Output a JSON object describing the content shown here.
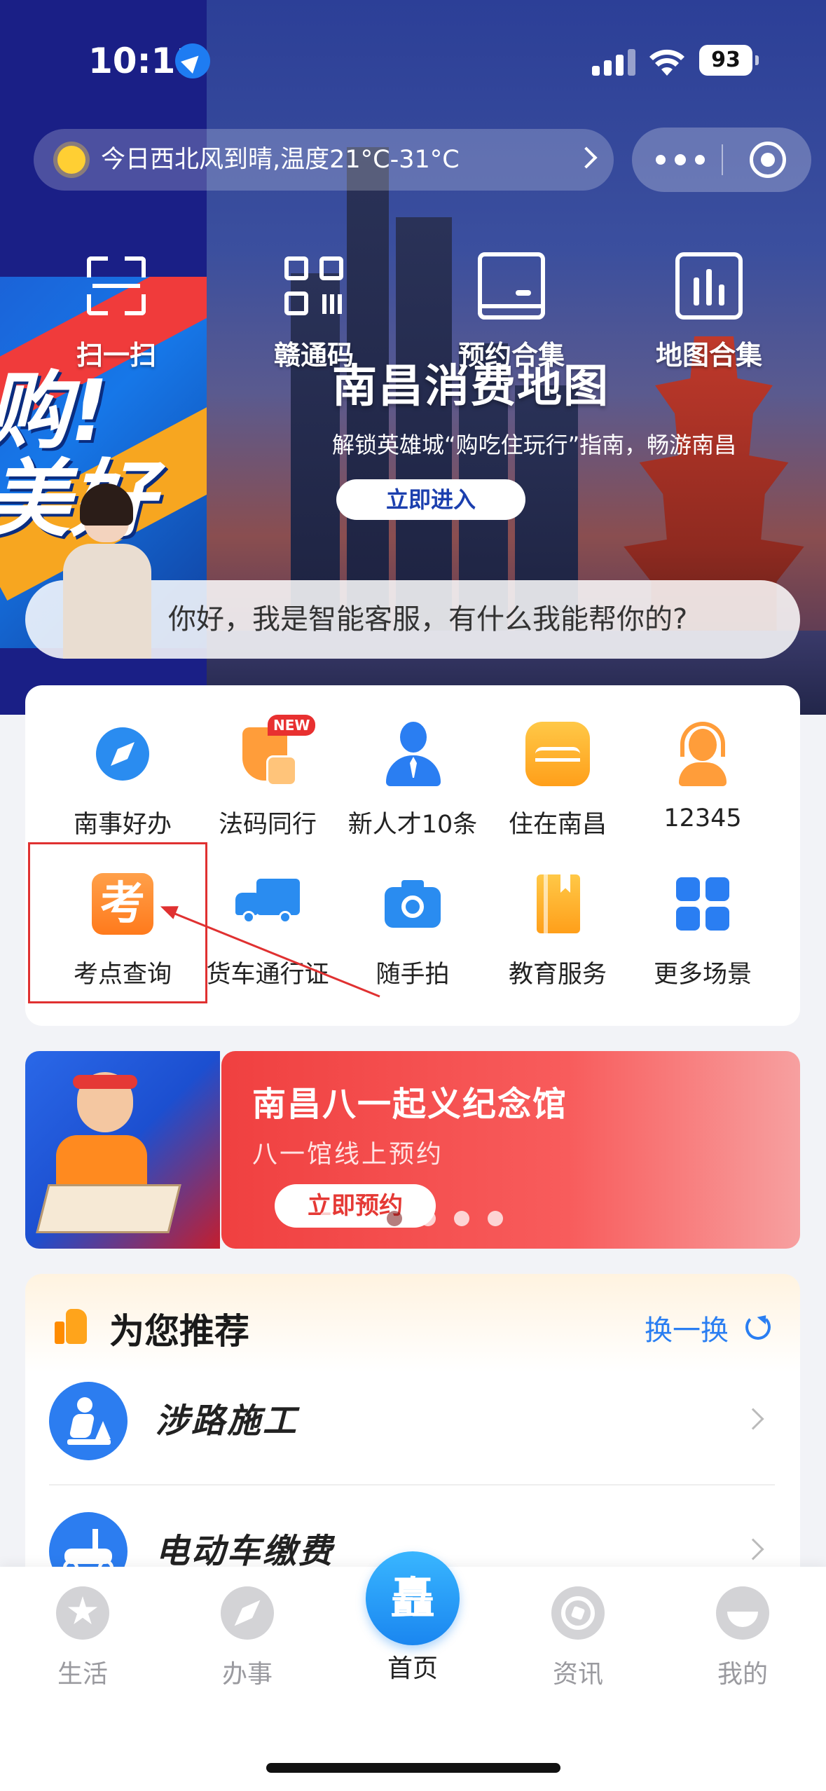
{
  "status_bar": {
    "time": "10:11",
    "battery": "93"
  },
  "weather": {
    "text": "今日西北风到晴,温度21°C-31°C"
  },
  "quick_actions": [
    {
      "label": "扫一扫",
      "icon": "scan-icon"
    },
    {
      "label": "赣通码",
      "icon": "qr-code-icon"
    },
    {
      "label": "预约合集",
      "icon": "appointment-icon"
    },
    {
      "label": "地图合集",
      "icon": "map-icon"
    }
  ],
  "hero": {
    "title": "南昌消费地图",
    "subtitle": "解锁英雄城“购吃住玩行”指南，畅游南昌",
    "button": "立即进入",
    "left_art_text": "购!\n美好"
  },
  "assistant": {
    "greeting": "你好，我是智能客服，有什么我能帮你的?"
  },
  "services": [
    {
      "label": "南事好办",
      "icon": "compass-icon",
      "color": "#2a8cf0"
    },
    {
      "label": "法码同行",
      "icon": "law-badge-icon",
      "color": "#ff9d3a",
      "badge": "NEW"
    },
    {
      "label": "新人才10条",
      "icon": "person-icon",
      "color": "#2a7ef2"
    },
    {
      "label": "住在南昌",
      "icon": "housing-icon",
      "color": "#ffb22c"
    },
    {
      "label": "12345",
      "icon": "headset-icon",
      "color": "#ff9d3a"
    },
    {
      "label": "考点查询",
      "icon": "exam-icon",
      "color": "#ff8c2a",
      "glyph": "考"
    },
    {
      "label": "货车通行证",
      "icon": "truck-icon",
      "color": "#2a8cf0"
    },
    {
      "label": "随手拍",
      "icon": "camera-icon",
      "color": "#2a8cf0"
    },
    {
      "label": "教育服务",
      "icon": "book-icon",
      "color": "#ffb22c"
    },
    {
      "label": "更多场景",
      "icon": "grid-icon",
      "color": "#2a7ef2"
    }
  ],
  "promo": {
    "title": "南昌八一起义纪念馆",
    "subtitle": "八一馆线上预约",
    "button": "立即预约",
    "active_dot": 1,
    "dot_count": 5
  },
  "recommend": {
    "title": "为您推荐",
    "refresh": "换一换",
    "items": [
      {
        "label": "涉路施工",
        "icon": "road-work-icon"
      },
      {
        "label": "电动车缴费",
        "icon": "scooter-icon"
      }
    ]
  },
  "tabs": [
    {
      "label": "生活",
      "icon": "star-icon"
    },
    {
      "label": "办事",
      "icon": "compass-icon"
    },
    {
      "label": "首页",
      "icon": "home-logo-icon",
      "active": true,
      "glyph": "矗"
    },
    {
      "label": "资讯",
      "icon": "aperture-icon"
    },
    {
      "label": "我的",
      "icon": "profile-icon"
    }
  ]
}
